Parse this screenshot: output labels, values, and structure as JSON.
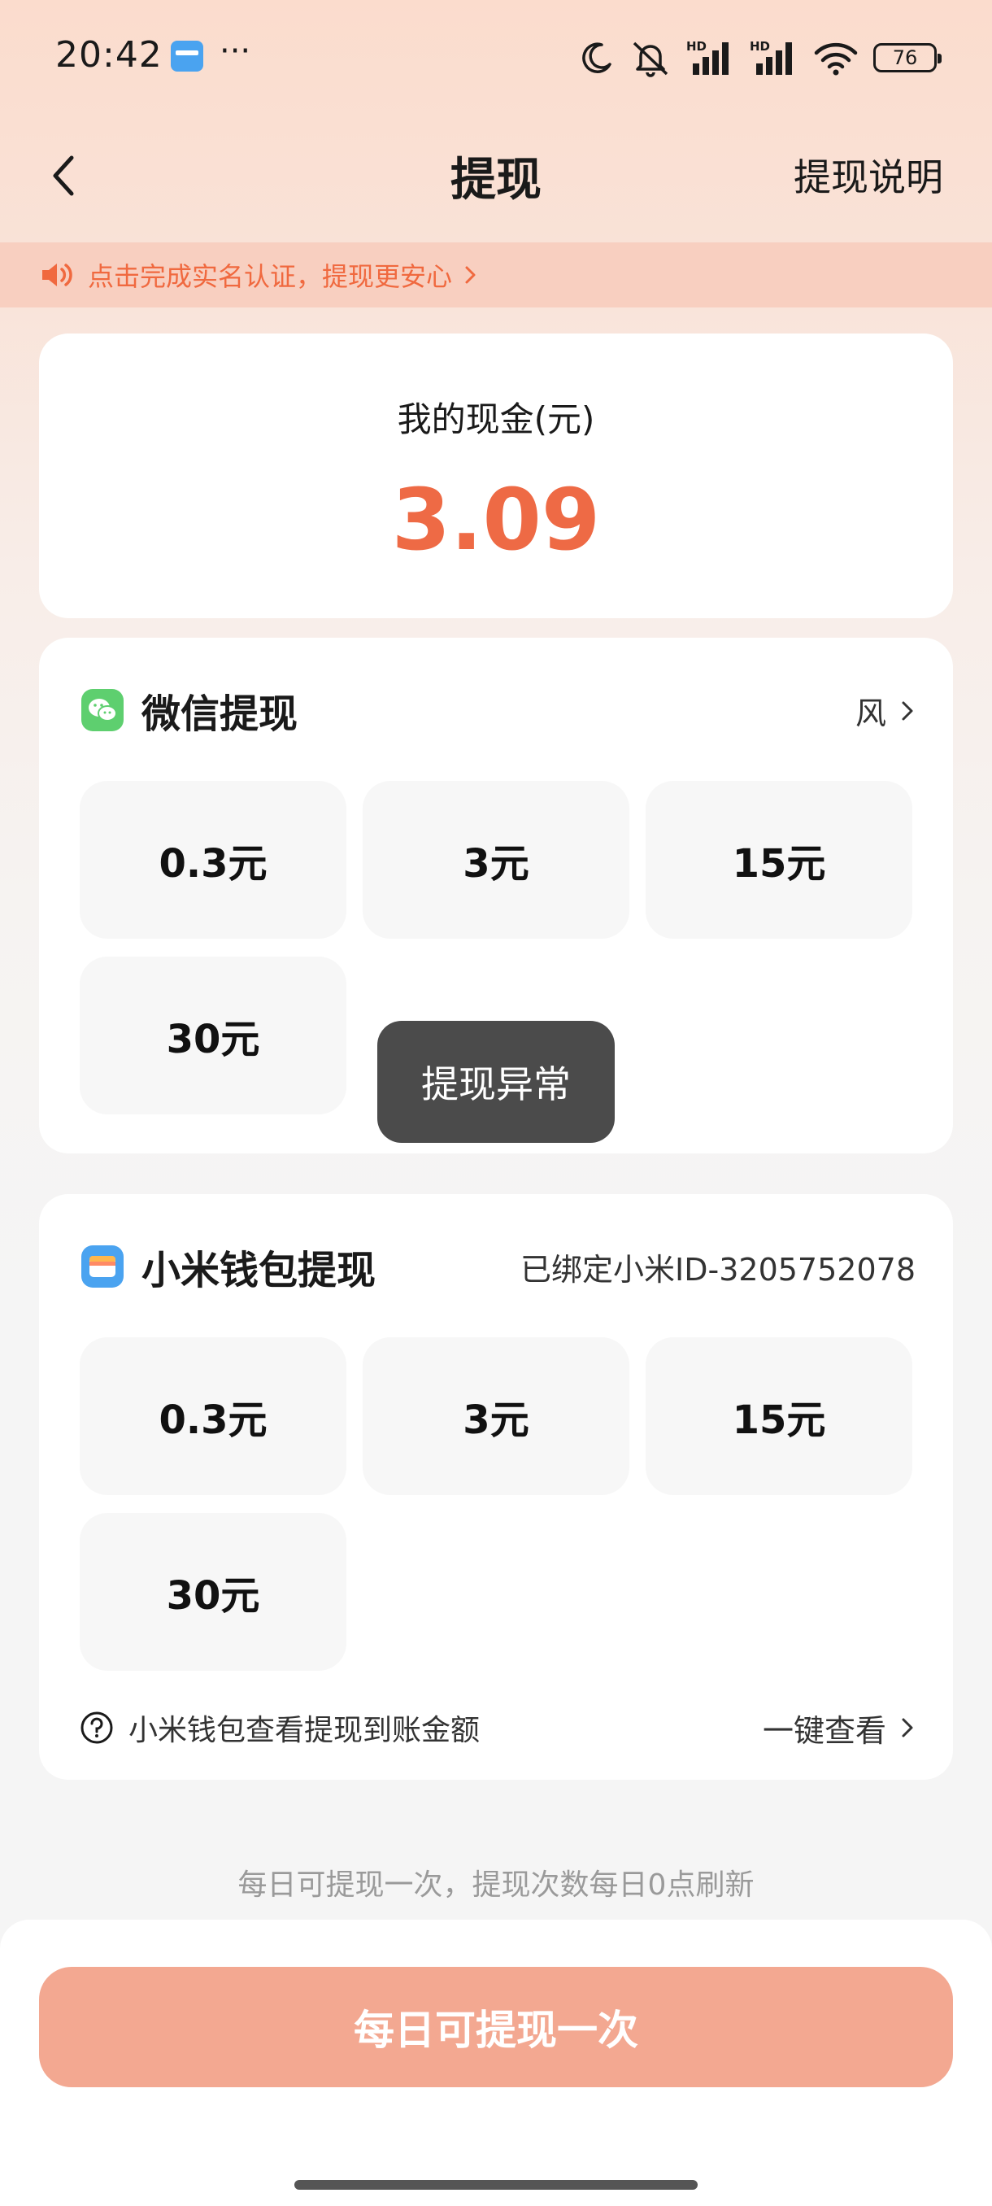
{
  "status_bar": {
    "time": "20:42",
    "more": "···",
    "hd_1": "HD",
    "hd_2": "HD",
    "battery": "76"
  },
  "nav": {
    "title": "提现",
    "right_link": "提现说明"
  },
  "notice": {
    "text": "点击完成实名认证，提现更安心"
  },
  "balance": {
    "label": "我的现金(元)",
    "value": "3.09"
  },
  "wechat": {
    "title": "微信提现",
    "account": "风",
    "options": [
      "0.3元",
      "3元",
      "15元",
      "30元"
    ]
  },
  "toast": {
    "text": "提现异常"
  },
  "wallet": {
    "title": "小米钱包提现",
    "bound": "已绑定小米ID-3205752078",
    "options": [
      "0.3元",
      "3元",
      "15元",
      "30元"
    ],
    "footer_left": "小米钱包查看提现到账金额",
    "footer_right": "一键查看"
  },
  "daily_note": "每日可提现一次，提现次数每日0点刷新",
  "bottom_button": "每日可提现一次",
  "colors": {
    "accent": "#ee6a45",
    "notice_text": "#f0693f",
    "button_bg": "#f3a891",
    "wechat_green": "#5ecf6f",
    "wallet_blue": "#4aa3f0"
  }
}
